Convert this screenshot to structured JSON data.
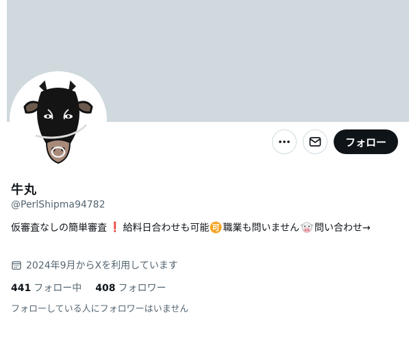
{
  "profile": {
    "display_name": "牛丸",
    "handle": "@PerlShipma94782",
    "bio": {
      "part1": "仮審査なしの簡単審査",
      "part2": "給料日合わせも可能",
      "part3": "職業も問いません",
      "part4": "問い合わせ→",
      "emoji_badge_text": "可"
    },
    "joined": "2024年9月からXを利用しています",
    "following_count": "441",
    "following_label": "フォロー中",
    "followers_count": "408",
    "followers_label": "フォロワー",
    "followers_you_know": "フォローしている人にフォロワーはいません"
  },
  "actions": {
    "follow_label": "フォロー"
  },
  "icons": {
    "more": "more-icon",
    "message": "envelope-icon",
    "calendar": "calendar-icon",
    "exclamation": "exclamation-emoji",
    "ok_badge": "ok-badge-emoji",
    "cow": "cow-face-emoji"
  },
  "colors": {
    "banner": "#cfd9de",
    "follow_button": "#0f1419",
    "secondary_text": "#536471",
    "badge_orange": "#f5a623"
  }
}
